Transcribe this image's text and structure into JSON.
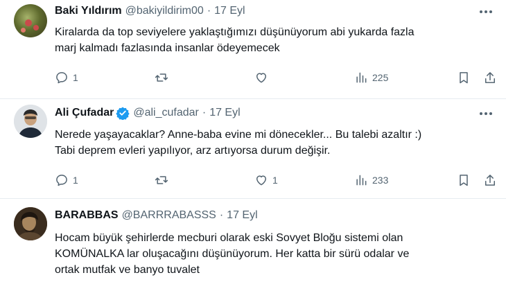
{
  "tweets": [
    {
      "name": "Baki Yıldırım",
      "handle": "@bakiyildirim00",
      "separator": "·",
      "date": "17 Eyl",
      "verified": false,
      "lines": [
        "Kiralarda da top seviyelere yaklaştığımızı düşünüyorum abi yukarda fazla",
        "marj kalmadı fazlasında insanlar ödeyemecek"
      ],
      "replies": "1",
      "retweets": "",
      "likes": "",
      "views": "225"
    },
    {
      "name": "Ali Çufadar",
      "handle": "@ali_cufadar",
      "separator": "·",
      "date": "17 Eyl",
      "verified": true,
      "lines": [
        "Nerede yaşayacaklar? Anne-baba evine mi dönecekler... Bu talebi azaltır :)",
        "Tabi deprem evleri yapılıyor, arz artıyorsa durum değişir."
      ],
      "replies": "1",
      "retweets": "",
      "likes": "1",
      "views": "233"
    },
    {
      "name": "BARABBAS",
      "handle": "@BARRRABASSS",
      "separator": "·",
      "date": "17 Eyl",
      "verified": false,
      "lines": [
        "Hocam büyük şehirlerde mecburi olarak eski Sovyet Bloğu sistemi olan",
        "KOMÜNALKA lar oluşacağını düşünüyorum. Her katta bir sürü odalar ve",
        "ortak mutfak ve banyo tuvalet"
      ]
    }
  ],
  "colors": {
    "text": "#0f1419",
    "secondary": "#536471",
    "verified": "#1d9bf0",
    "divider": "#e6ecf0"
  },
  "icons": [
    "reply-icon",
    "retweet-icon",
    "like-icon",
    "views-icon",
    "bookmark-icon",
    "share-icon",
    "more-icon",
    "verified-badge-icon"
  ]
}
